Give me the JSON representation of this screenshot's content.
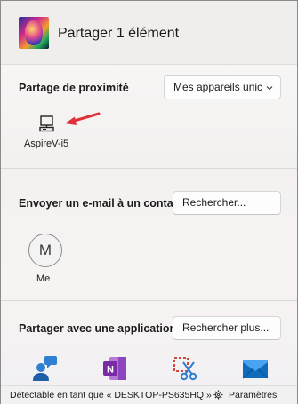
{
  "header": {
    "title": "Partager 1 élément"
  },
  "nearby": {
    "label": "Partage de proximité",
    "dropdown_value": "Mes appareils unic",
    "device": {
      "name": "AspireV-i5",
      "icon": "desktop-pc-icon"
    }
  },
  "email": {
    "label": "Envoyer un e-mail à un contact",
    "search_button": "Rechercher...",
    "contact": {
      "initial": "M",
      "name": "Me"
    }
  },
  "apps": {
    "label": "Partager avec une application",
    "search_button": "Rechercher plus...",
    "items": [
      {
        "icon": "people-chat-icon"
      },
      {
        "icon": "onenote-icon"
      },
      {
        "icon": "snipping-tool-icon"
      },
      {
        "icon": "mail-icon"
      }
    ]
  },
  "footer": {
    "discoverable_text": "Détectable en tant que « DESKTOP-PS635HQ »",
    "settings_label": "Paramètres",
    "settings_icon": "gear-icon"
  },
  "colors": {
    "arrow": "#e0313a",
    "onenote": "#7b2aa6",
    "mail": "#0f6cbd",
    "people": "#2f7fd3"
  }
}
